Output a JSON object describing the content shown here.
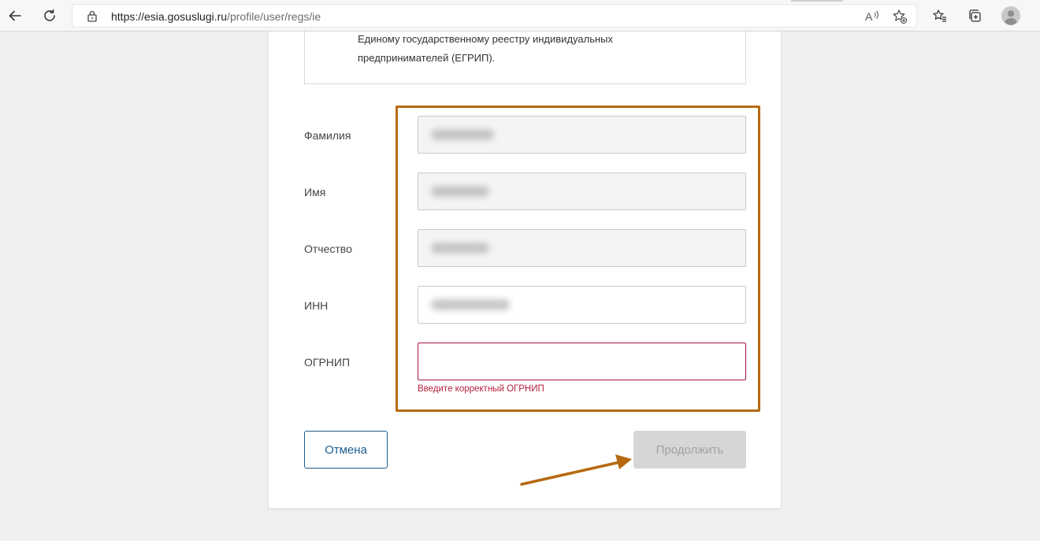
{
  "browser": {
    "url_host": "https://esia.gosuslugi.ru",
    "url_path": "/profile/user/regs/ie",
    "icons": {
      "back": "arrow-left-icon",
      "refresh": "refresh-icon",
      "lock": "lock-icon",
      "read_aloud": "read-aloud-icon",
      "add_favorite": "star-add-icon",
      "favorites": "favorites-icon",
      "collections": "collections-icon",
      "profile": "profile-avatar-icon"
    }
  },
  "info": {
    "line1": "Единому государственному реестру индивидуальных",
    "line2": "предпринимателей (ЕГРИП)."
  },
  "form": {
    "fields": [
      {
        "label": "Фамилия",
        "state": "disabled"
      },
      {
        "label": "Имя",
        "state": "disabled"
      },
      {
        "label": "Отчество",
        "state": "disabled"
      },
      {
        "label": "ИНН",
        "state": "editable"
      },
      {
        "label": "ОГРНИП",
        "state": "error"
      }
    ],
    "error_message": "Введите корректный ОГРНИП",
    "cancel_label": "Отмена",
    "continue_label": "Продолжить"
  },
  "colors": {
    "highlight": "#b56a12",
    "error": "#a5173c",
    "primary": "#1d5d90"
  }
}
